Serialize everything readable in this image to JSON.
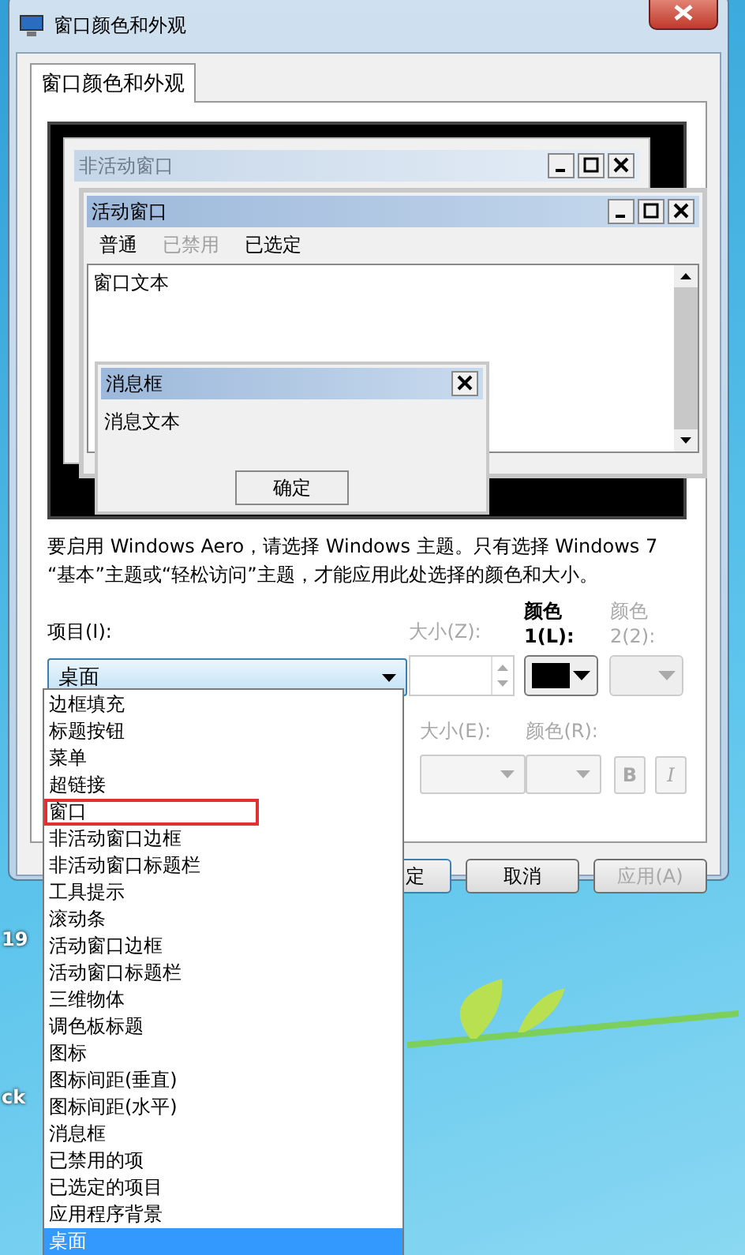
{
  "window": {
    "title": "窗口颜色和外观"
  },
  "tabs": [
    {
      "label": "窗口颜色和外观",
      "selected": true
    }
  ],
  "preview": {
    "inactive_window": {
      "title": "非活动窗口"
    },
    "active_window": {
      "title": "活动窗口",
      "menu": [
        {
          "label": "普通",
          "disabled": false
        },
        {
          "label": "已禁用",
          "disabled": true
        },
        {
          "label": "已选定",
          "disabled": false
        }
      ],
      "text": "窗口文本"
    },
    "message_box": {
      "title": "消息框",
      "text": "消息文本",
      "button": "确定"
    }
  },
  "description": "要启用 Windows Aero，请选择 Windows 主题。只有选择 Windows 7 “基本”主题或“轻松访问”主题，才能应用此处选择的颜色和大小。",
  "item": {
    "label": "项目(I):",
    "value": "桌面",
    "options": [
      {
        "label": "边框填充",
        "selected": false,
        "marked": false
      },
      {
        "label": "标题按钮",
        "selected": false,
        "marked": false
      },
      {
        "label": "菜单",
        "selected": false,
        "marked": false
      },
      {
        "label": "超链接",
        "selected": false,
        "marked": false
      },
      {
        "label": "窗口",
        "selected": false,
        "marked": true
      },
      {
        "label": "非活动窗口边框",
        "selected": false,
        "marked": false
      },
      {
        "label": "非活动窗口标题栏",
        "selected": false,
        "marked": false
      },
      {
        "label": "工具提示",
        "selected": false,
        "marked": false
      },
      {
        "label": "滚动条",
        "selected": false,
        "marked": false
      },
      {
        "label": "活动窗口边框",
        "selected": false,
        "marked": false
      },
      {
        "label": "活动窗口标题栏",
        "selected": false,
        "marked": false
      },
      {
        "label": "三维物体",
        "selected": false,
        "marked": false
      },
      {
        "label": "调色板标题",
        "selected": false,
        "marked": false
      },
      {
        "label": "图标",
        "selected": false,
        "marked": false
      },
      {
        "label": "图标间距(垂直)",
        "selected": false,
        "marked": false
      },
      {
        "label": "图标间距(水平)",
        "selected": false,
        "marked": false
      },
      {
        "label": "消息框",
        "selected": false,
        "marked": false
      },
      {
        "label": "已禁用的项",
        "selected": false,
        "marked": false
      },
      {
        "label": "已选定的项目",
        "selected": false,
        "marked": false
      },
      {
        "label": "应用程序背景",
        "selected": false,
        "marked": false
      },
      {
        "label": "桌面",
        "selected": true,
        "marked": false
      }
    ]
  },
  "size1": {
    "label": "大小(Z):",
    "disabled": true
  },
  "color1": {
    "label_1": "颜色",
    "label_2": "1(L):",
    "disabled": false,
    "color": "#000000"
  },
  "color2": {
    "label_1": "颜色",
    "label_2": "2(2):",
    "disabled": true
  },
  "font_size": {
    "label": "大小(E):",
    "disabled": true
  },
  "font_color": {
    "label": "颜色(R):",
    "disabled": true
  },
  "bold": {
    "label": "B",
    "disabled": true
  },
  "italic": {
    "label": "I",
    "disabled": true
  },
  "buttons": [
    {
      "label": "定",
      "default": true,
      "disabled": false
    },
    {
      "label": "取消",
      "default": false,
      "disabled": false
    },
    {
      "label": "应用(A)",
      "default": false,
      "disabled": true
    }
  ],
  "desktop_icons": [
    {
      "label": "19"
    },
    {
      "label": "ck"
    }
  ]
}
